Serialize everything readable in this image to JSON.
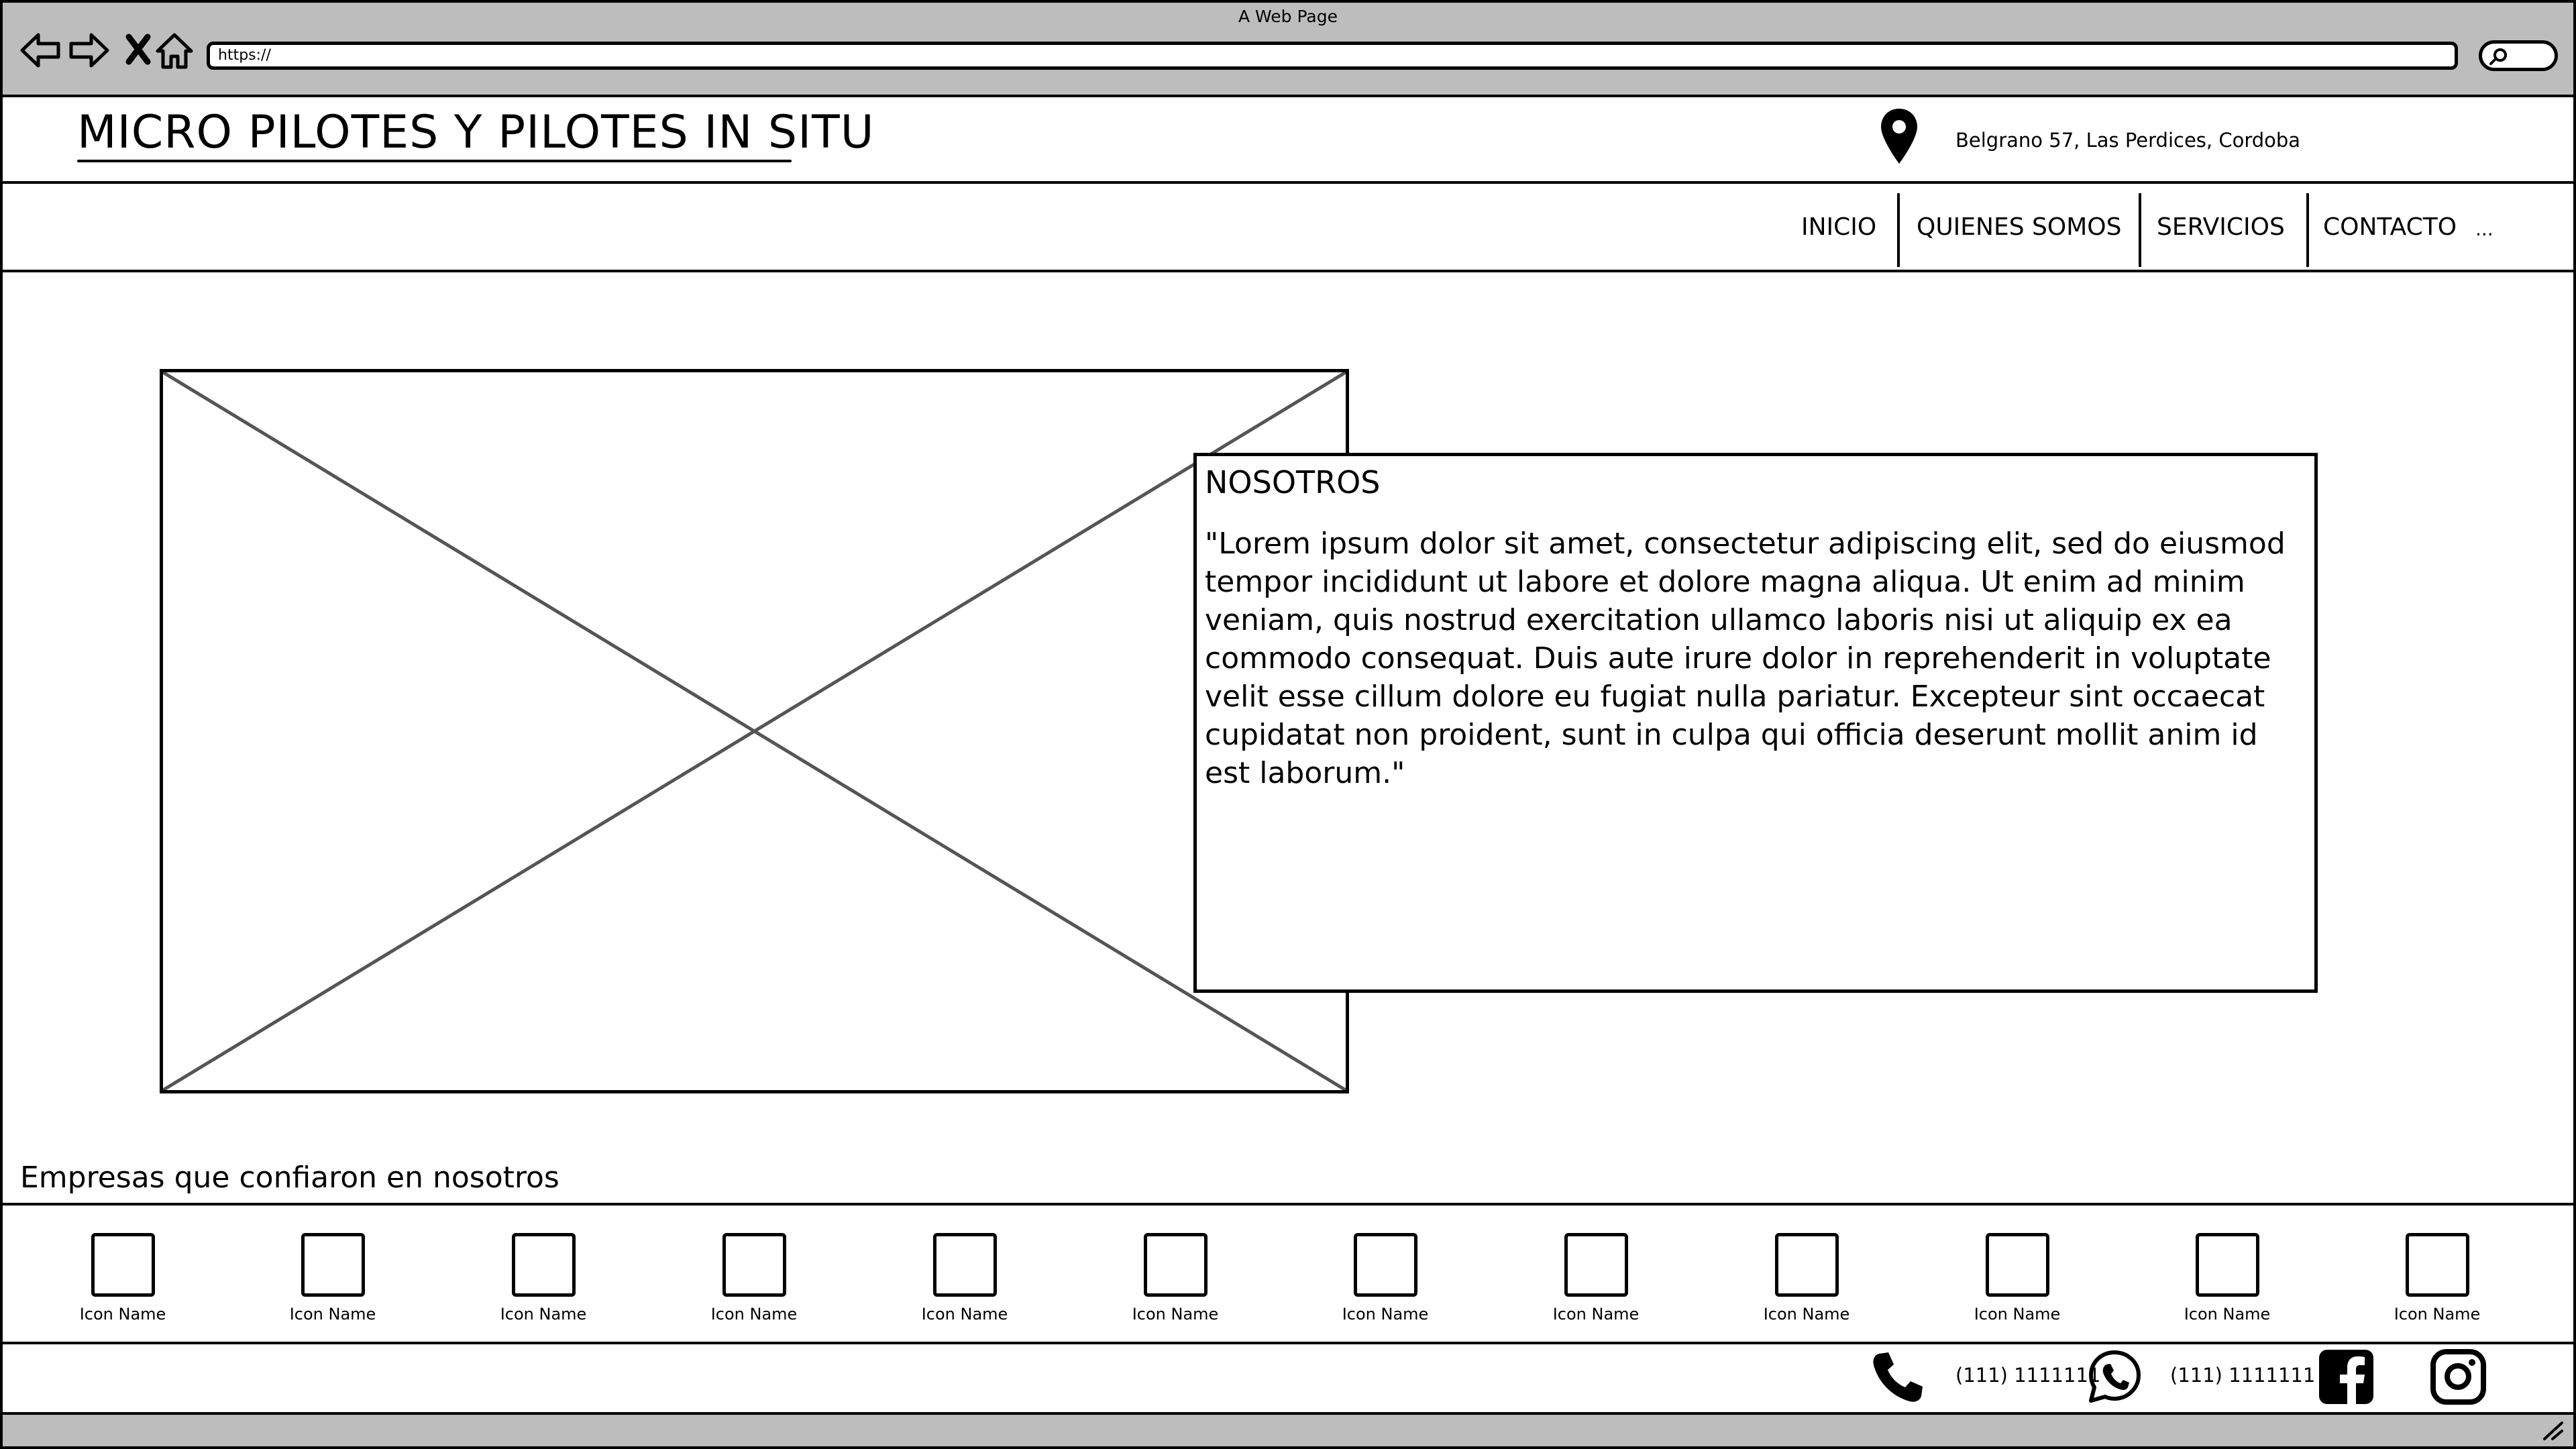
{
  "browser": {
    "window_title": "A Web Page",
    "url": "https://"
  },
  "header": {
    "site_title": "MICRO PILOTES Y PILOTES IN SITU",
    "address": "Belgrano 57, Las Perdices, Cordoba"
  },
  "menu": {
    "items": [
      "INICIO",
      "QUIENES SOMOS",
      "SERVICIOS",
      "CONTACTO",
      "..."
    ]
  },
  "about": {
    "heading": "NOSOTROS",
    "body": "\"Lorem ipsum dolor sit amet, consectetur adipiscing elit, sed do eiusmod tempor incididunt ut labore et dolore magna aliqua. Ut enim ad minim veniam, quis nostrud exercitation ullamco laboris nisi ut aliquip ex ea commodo consequat. Duis aute irure dolor in reprehenderit in voluptate velit esse cillum dolore eu fugiat nulla pariatur. Excepteur sint occaecat cupidatat non proident, sunt in culpa qui officia deserunt mollit anim id est laborum.\""
  },
  "companies": {
    "label": "Empresas que confiaron en nosotros",
    "icons": [
      "Icon Name",
      "Icon Name",
      "Icon Name",
      "Icon Name",
      "Icon Name",
      "Icon Name",
      "Icon Name",
      "Icon Name",
      "Icon Name",
      "Icon Name",
      "Icon Name",
      "Icon Name"
    ]
  },
  "footer": {
    "phone": "(111) 1111111",
    "whatsapp": "(111) 1111111",
    "icons": [
      "phone-icon",
      "whatsapp-icon",
      "facebook-icon",
      "instagram-icon"
    ]
  }
}
